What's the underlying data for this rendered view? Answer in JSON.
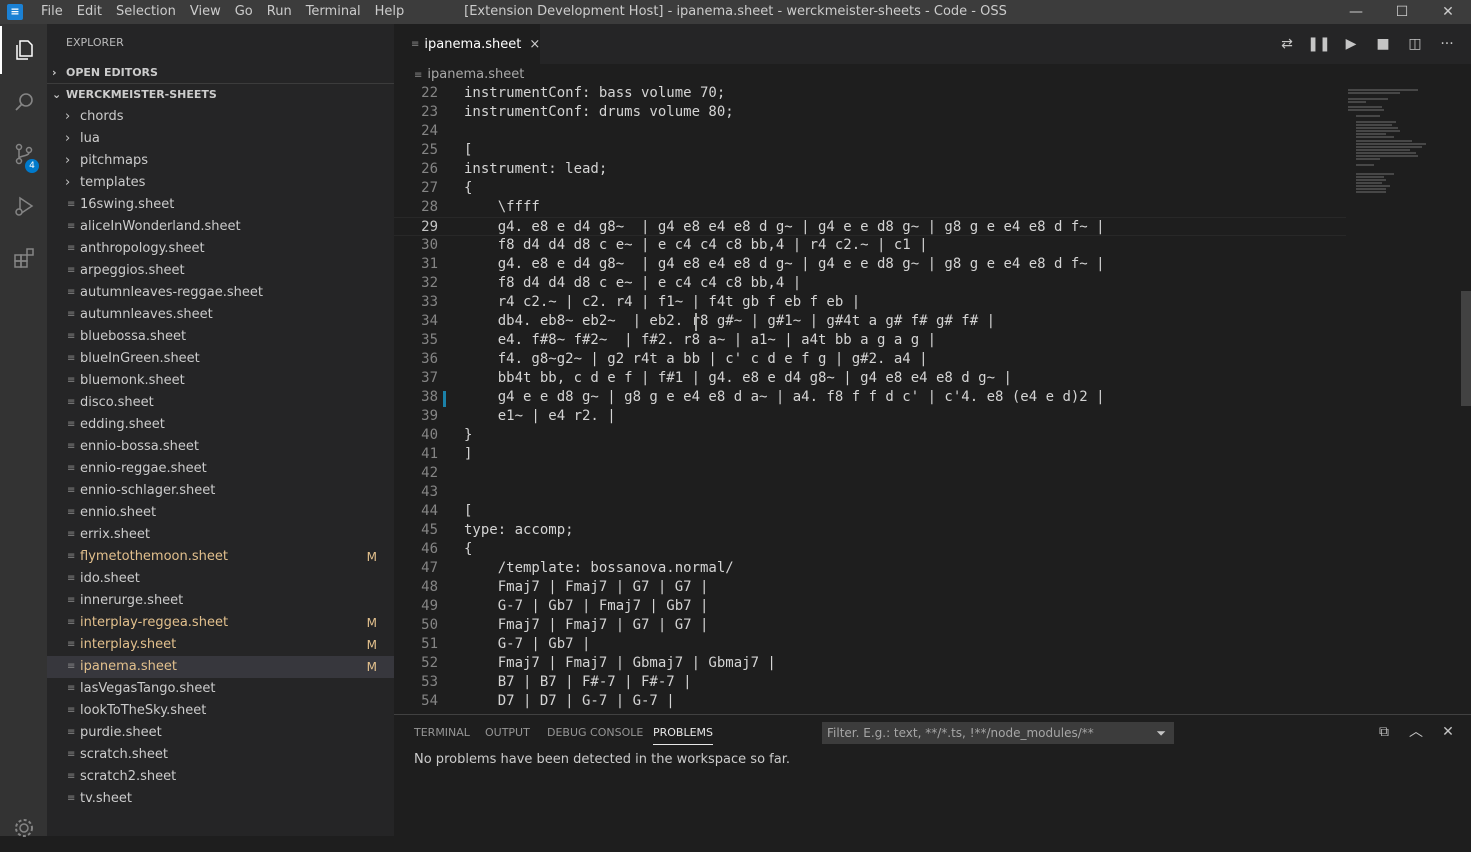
{
  "titlebar": {
    "menus": [
      "File",
      "Edit",
      "Selection",
      "View",
      "Go",
      "Run",
      "Terminal",
      "Help"
    ],
    "title": "[Extension Development Host] - ipanema.sheet - werckmeister-sheets - Code - OSS",
    "controls": [
      "—",
      "☐",
      "✕"
    ]
  },
  "activitybar": {
    "items": [
      "explorer-icon",
      "search-icon",
      "source-control-icon",
      "run-debug-icon",
      "extensions-icon"
    ],
    "scm_badge": "4",
    "accent": "#007acc"
  },
  "sidebar": {
    "title": "EXPLORER",
    "open_editors": "OPEN EDITORS",
    "workspace": "WERCKMEISTER-SHEETS",
    "folders": [
      "chords",
      "lua",
      "pitchmaps",
      "templates"
    ],
    "files": [
      {
        "name": "16swing.sheet",
        "badge": ""
      },
      {
        "name": "aliceInWonderland.sheet",
        "badge": ""
      },
      {
        "name": "anthropology.sheet",
        "badge": ""
      },
      {
        "name": "arpeggios.sheet",
        "badge": ""
      },
      {
        "name": "autumnleaves-reggae.sheet",
        "badge": ""
      },
      {
        "name": "autumnleaves.sheet",
        "badge": ""
      },
      {
        "name": "bluebossa.sheet",
        "badge": ""
      },
      {
        "name": "blueInGreen.sheet",
        "badge": ""
      },
      {
        "name": "bluemonk.sheet",
        "badge": ""
      },
      {
        "name": "disco.sheet",
        "badge": ""
      },
      {
        "name": "edding.sheet",
        "badge": ""
      },
      {
        "name": "ennio-bossa.sheet",
        "badge": ""
      },
      {
        "name": "ennio-reggae.sheet",
        "badge": ""
      },
      {
        "name": "ennio-schlager.sheet",
        "badge": ""
      },
      {
        "name": "ennio.sheet",
        "badge": ""
      },
      {
        "name": "errix.sheet",
        "badge": ""
      },
      {
        "name": "flymetothemoon.sheet",
        "badge": "M"
      },
      {
        "name": "ido.sheet",
        "badge": ""
      },
      {
        "name": "innerurge.sheet",
        "badge": ""
      },
      {
        "name": "interplay-reggea.sheet",
        "badge": "M"
      },
      {
        "name": "interplay.sheet",
        "badge": "M"
      },
      {
        "name": "ipanema.sheet",
        "badge": "M"
      },
      {
        "name": "lasVegasTango.sheet",
        "badge": ""
      },
      {
        "name": "lookToTheSky.sheet",
        "badge": ""
      },
      {
        "name": "purdie.sheet",
        "badge": ""
      },
      {
        "name": "scratch.sheet",
        "badge": ""
      },
      {
        "name": "scratch2.sheet",
        "badge": ""
      },
      {
        "name": "tv.sheet",
        "badge": ""
      }
    ],
    "selected_file": "ipanema.sheet",
    "modified_color": "#e2c08d"
  },
  "editor": {
    "tab": "ipanema.sheet",
    "breadcrumb": "ipanema.sheet",
    "current_line": "29",
    "lines": [
      {
        "n": "22",
        "t": "instrumentConf: bass volume 70;"
      },
      {
        "n": "23",
        "t": "instrumentConf: drums volume 80;"
      },
      {
        "n": "24",
        "t": ""
      },
      {
        "n": "25",
        "t": "["
      },
      {
        "n": "26",
        "t": "instrument: lead;"
      },
      {
        "n": "27",
        "t": "{"
      },
      {
        "n": "28",
        "t": "    \\ffff"
      },
      {
        "n": "29",
        "t": "    g4. e8 e d4 g8~  | g4 e8 e4 e8 d g~ | g4 e e d8 g~ | g8 g e e4 e8 d f~ |"
      },
      {
        "n": "30",
        "t": "    f8 d4 d4 d8 c e~ | e c4 c4 c8 bb,4 | r4 c2.~ | c1 |"
      },
      {
        "n": "31",
        "t": "    g4. e8 e d4 g8~  | g4 e8 e4 e8 d g~ | g4 e e d8 g~ | g8 g e e4 e8 d f~ |"
      },
      {
        "n": "32",
        "t": "    f8 d4 d4 d8 c e~ | e c4 c4 c8 bb,4 |"
      },
      {
        "n": "33",
        "t": "    r4 c2.~ | c2. r4 | f1~ | f4t gb f eb f eb |"
      },
      {
        "n": "34",
        "t": "    db4. eb8~ eb2~  | eb2. r8 g#~ | g#1~ | g#4t a g# f# g# f# |"
      },
      {
        "n": "35",
        "t": "    e4. f#8~ f#2~  | f#2. r8 a~ | a1~ | a4t bb a g a g |"
      },
      {
        "n": "36",
        "t": "    f4. g8~g2~ | g2 r4t a bb | c' c d e f g | g#2. a4 |"
      },
      {
        "n": "37",
        "t": "    bb4t bb, c d e f | f#1 | g4. e8 e d4 g8~ | g4 e8 e4 e8 d g~ |"
      },
      {
        "n": "38",
        "t": "    g4 e e d8 g~ | g8 g e e4 e8 d a~ | a4. f8 f f d c' | c'4. e8 (e4 e d)2 |"
      },
      {
        "n": "39",
        "t": "    e1~ | e4 r2. |"
      },
      {
        "n": "40",
        "t": "}"
      },
      {
        "n": "41",
        "t": "]"
      },
      {
        "n": "42",
        "t": ""
      },
      {
        "n": "43",
        "t": ""
      },
      {
        "n": "44",
        "t": "["
      },
      {
        "n": "45",
        "t": "type: accomp;"
      },
      {
        "n": "46",
        "t": "{"
      },
      {
        "n": "47",
        "t": "    /template: bossanova.normal/"
      },
      {
        "n": "48",
        "t": "    Fmaj7 | Fmaj7 | G7 | G7 |"
      },
      {
        "n": "49",
        "t": "    G-7 | Gb7 | Fmaj7 | Gb7 |"
      },
      {
        "n": "50",
        "t": "    Fmaj7 | Fmaj7 | G7 | G7 |"
      },
      {
        "n": "51",
        "t": "    G-7 | Gb7 |"
      },
      {
        "n": "52",
        "t": "    Fmaj7 | Fmaj7 | Gbmaj7 | Gbmaj7 |"
      },
      {
        "n": "53",
        "t": "    B7 | B7 | F#-7 | F#-7 |"
      },
      {
        "n": "54",
        "t": "    D7 | D7 | G-7 | G-7 |"
      }
    ]
  },
  "panel": {
    "tabs": [
      "TERMINAL",
      "OUTPUT",
      "DEBUG CONSOLE",
      "PROBLEMS"
    ],
    "active_tab": "PROBLEMS",
    "filter_placeholder": "Filter. E.g.: text, **/*.ts, !**/node_modules/**",
    "message": "No problems have been detected in the workspace so far."
  }
}
